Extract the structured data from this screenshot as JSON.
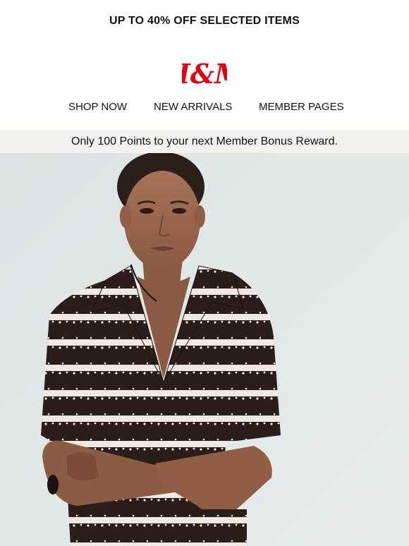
{
  "promo": {
    "text": "UP TO 40% OFF SELECTED ITEMS"
  },
  "brand": {
    "logo_text": "H&M",
    "logo_color": "#e50010"
  },
  "nav": {
    "items": [
      {
        "label": "SHOP NOW"
      },
      {
        "label": "NEW ARRIVALS"
      },
      {
        "label": "MEMBER PAGES"
      }
    ]
  },
  "member": {
    "points_message": "Only 100 Points to your next Member Bonus Reward."
  },
  "hero": {
    "description_icon": "model-photo",
    "background_color": "#dde6e6",
    "garment_color": "#2a1d1a",
    "stripe_color": "#f1ece6"
  }
}
